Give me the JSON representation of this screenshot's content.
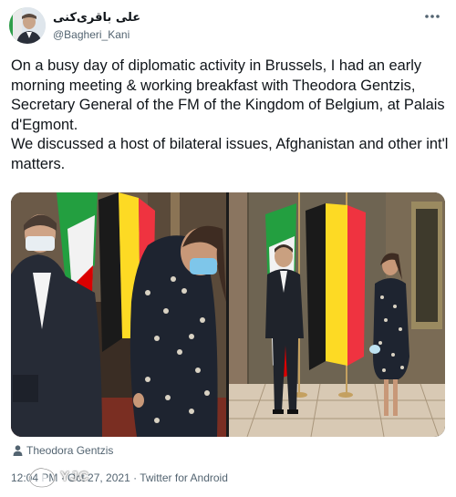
{
  "author": {
    "display_name": "علی باقری‌کنی",
    "handle": "@Bagheri_Kani"
  },
  "tweet": {
    "text": "On a busy day of diplomatic activity in Brussels, I had an early morning meeting & working breakfast with Theodora Gentzis, Secretary General of the FM of the Kingdom of Belgium, at Palais d'Egmont.\nWe discussed a host of bilateral issues, Afghanistan and other int'l matters.",
    "tagged_person": "Theodora Gentzis",
    "timestamp": "12:04 PM · Oct 27, 2021 · Twitter for Android"
  },
  "watermark": {
    "text": "YJC"
  },
  "colors": {
    "text": "#0f1419",
    "secondary": "#536471",
    "flag_green": "#239f40",
    "flag_red": "#da0000",
    "belgium_black": "#1a1a1a",
    "belgium_yellow": "#fdda24",
    "belgium_red": "#ef3340"
  },
  "icons": [
    "more-icon",
    "person-icon"
  ]
}
